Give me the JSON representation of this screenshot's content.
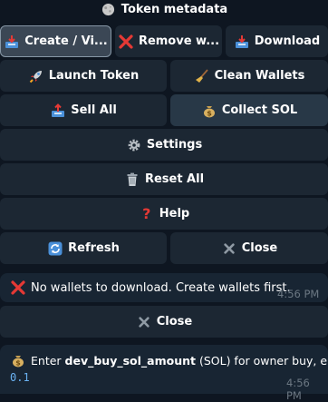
{
  "header": {
    "title": "Token metadata",
    "icon": "moon-icon"
  },
  "keyboard1": {
    "create_view": "Create / Vi...",
    "remove_wallets": "Remove w...",
    "download": "Download",
    "launch_token": "Launch Token",
    "clean_wallets": "Clean Wallets",
    "sell_all": "Sell All",
    "collect_sol": "Collect SOL",
    "settings": "Settings",
    "reset_all": "Reset All",
    "help": "Help",
    "refresh": "Refresh",
    "close": "Close"
  },
  "messages": {
    "no_wallets": {
      "text": "No wallets to download. Create wallets first.",
      "time": "4:56 PM"
    },
    "close_button": "Close",
    "dev_buy": {
      "prefix": "Enter ",
      "bold": "dev_buy_sol_amount",
      "suffix": " (SOL) for owner buy, e.g.",
      "example": "0.1",
      "time": "4:56 PM"
    }
  },
  "colors": {
    "background": "#0e1621",
    "button": "#1c2733",
    "bubble": "#182533",
    "accent_red": "#e53935",
    "link": "#6ab2f2"
  }
}
